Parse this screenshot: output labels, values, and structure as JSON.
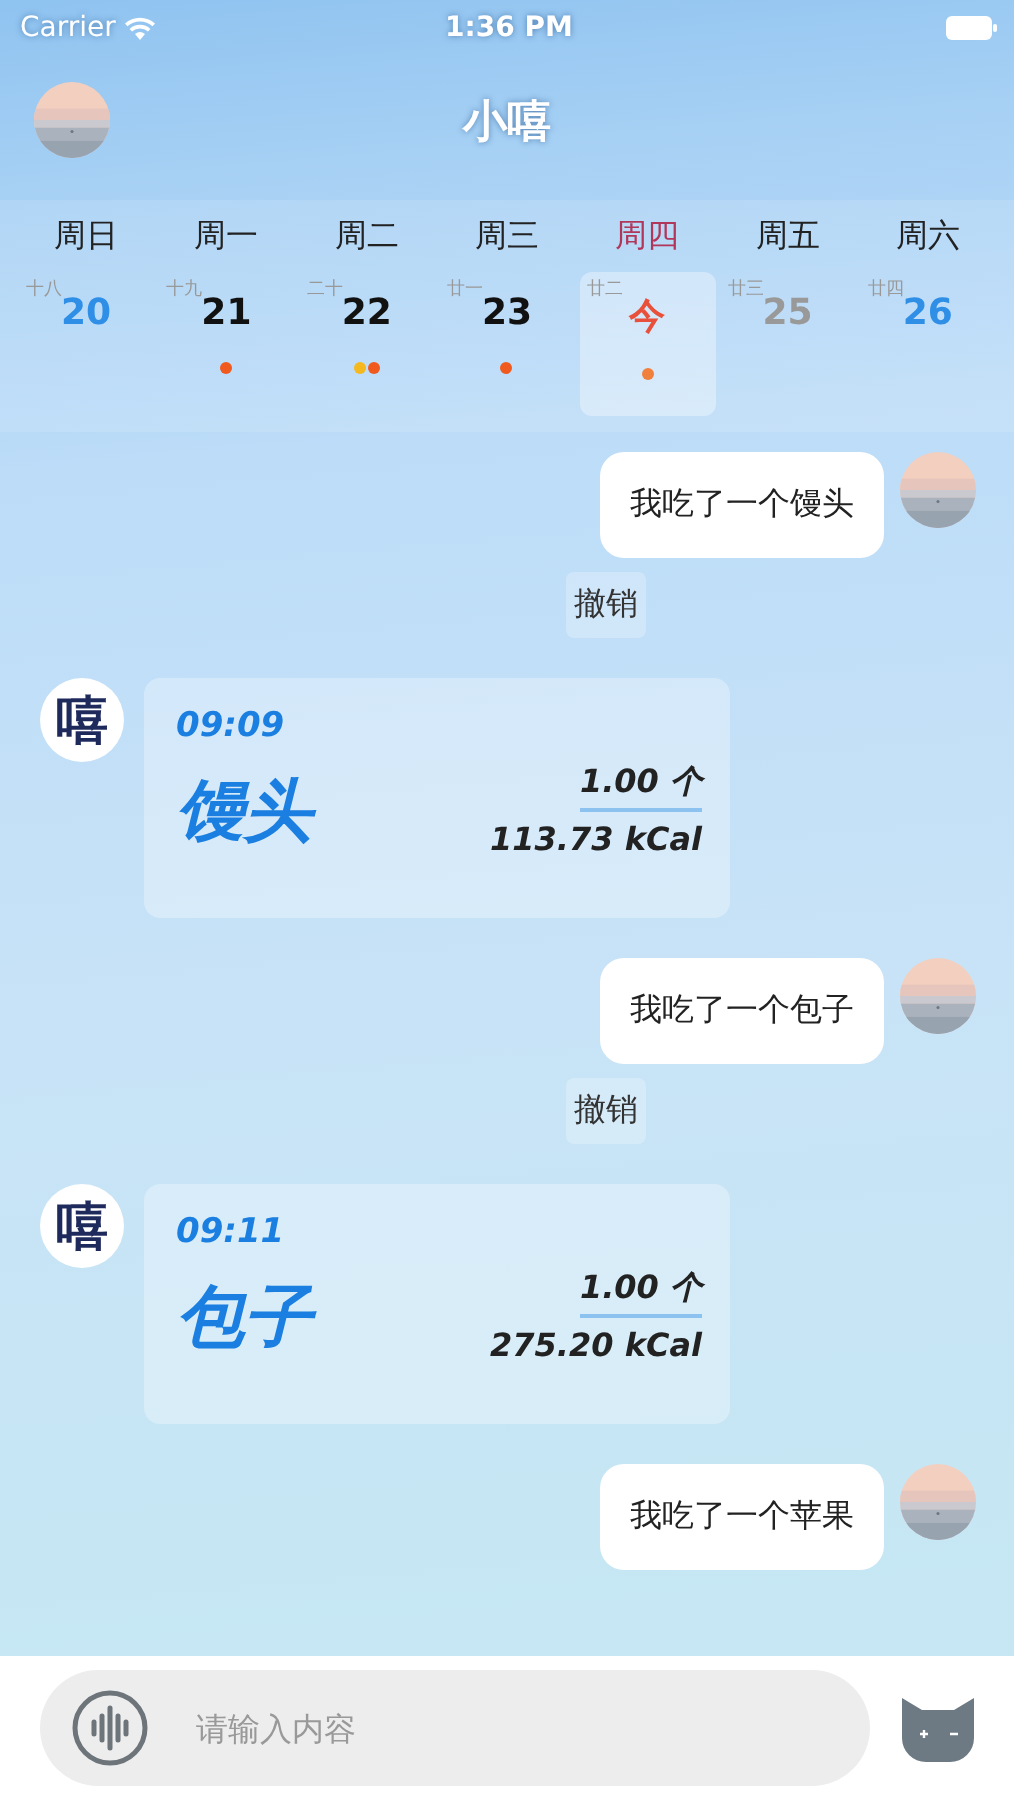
{
  "status_bar": {
    "carrier": "Carrier",
    "time": "1:36 PM"
  },
  "header": {
    "title": "小嘻"
  },
  "calendar": {
    "days": [
      {
        "weekday": "周日",
        "lunar": "十八",
        "day": "20",
        "kind": "weekend",
        "selected": false
      },
      {
        "weekday": "周一",
        "lunar": "十九",
        "day": "21",
        "kind": "past",
        "selected": false,
        "dots": [
          {
            "color": "#f05a1e"
          }
        ]
      },
      {
        "weekday": "周二",
        "lunar": "二十",
        "day": "22",
        "kind": "past",
        "selected": false,
        "dots": [
          {
            "color": "#f5b81e"
          },
          {
            "color": "#f05a1e"
          }
        ]
      },
      {
        "weekday": "周三",
        "lunar": "廿一",
        "day": "23",
        "kind": "past",
        "selected": false,
        "dots": [
          {
            "color": "#f05a1e"
          }
        ]
      },
      {
        "weekday": "周四",
        "lunar": "廿二",
        "day": "今",
        "kind": "today",
        "selected": true,
        "dots": [
          {
            "color": "#f0803c"
          }
        ]
      },
      {
        "weekday": "周五",
        "lunar": "廿三",
        "day": "25",
        "kind": "future",
        "selected": false
      },
      {
        "weekday": "周六",
        "lunar": "廿四",
        "day": "26",
        "kind": "weekend",
        "selected": false
      }
    ]
  },
  "messages": [
    {
      "kind": "user",
      "text": "我吃了一个馒头",
      "undo": "撤销"
    },
    {
      "kind": "bot",
      "avatar": "嘻",
      "time": "09:09",
      "food": "馒头",
      "amount": "1.00 个",
      "energy": "113.73 kCal"
    },
    {
      "kind": "user",
      "text": "我吃了一个包子",
      "undo": "撤销"
    },
    {
      "kind": "bot",
      "avatar": "嘻",
      "time": "09:11",
      "food": "包子",
      "amount": "1.00 个",
      "energy": "275.20 kCal"
    },
    {
      "kind": "user",
      "text": "我吃了一个苹果"
    }
  ],
  "input_bar": {
    "placeholder": "请输入内容"
  }
}
